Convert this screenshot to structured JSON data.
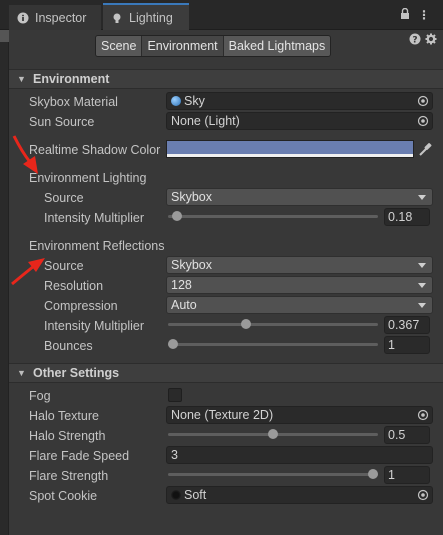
{
  "window": {
    "tabs": [
      {
        "label": "Inspector",
        "icon": "info-icon"
      },
      {
        "label": "Lighting",
        "icon": "bulb-icon"
      }
    ],
    "more_menu": "⋮"
  },
  "toolbar": {
    "buttons": [
      "Scene",
      "Environment",
      "Baked Lightmaps"
    ],
    "selected": "Environment"
  },
  "environment": {
    "header": "Environment",
    "skybox_material": {
      "label": "Skybox Material",
      "value": "Sky"
    },
    "sun_source": {
      "label": "Sun Source",
      "value": "None (Light)"
    },
    "realtime_shadow_color": {
      "label": "Realtime Shadow Color",
      "color": "#6a7eb0"
    },
    "lighting": {
      "header": "Environment Lighting",
      "source": {
        "label": "Source",
        "value": "Skybox"
      },
      "intensity": {
        "label": "Intensity Multiplier",
        "value": "0.18",
        "fraction": 0.02
      }
    },
    "reflections": {
      "header": "Environment Reflections",
      "source": {
        "label": "Source",
        "value": "Skybox"
      },
      "resolution": {
        "label": "Resolution",
        "value": "128"
      },
      "compression": {
        "label": "Compression",
        "value": "Auto"
      },
      "intensity": {
        "label": "Intensity Multiplier",
        "value": "0.367",
        "fraction": 0.367
      },
      "bounces": {
        "label": "Bounces",
        "value": "1",
        "fraction": 0.0
      }
    }
  },
  "other": {
    "header": "Other Settings",
    "fog": {
      "label": "Fog",
      "checked": false
    },
    "halo_texture": {
      "label": "Halo Texture",
      "value": "None (Texture 2D)"
    },
    "halo_strength": {
      "label": "Halo Strength",
      "value": "0.5",
      "fraction": 0.5
    },
    "flare_fade_speed": {
      "label": "Flare Fade Speed",
      "value": "3"
    },
    "flare_strength": {
      "label": "Flare Strength",
      "value": "1",
      "fraction": 1.0
    },
    "spot_cookie": {
      "label": "Spot Cookie",
      "value": "Soft"
    }
  },
  "colors": {
    "annotation_arrow": "#e8261b",
    "accent": "#3a79bb"
  }
}
